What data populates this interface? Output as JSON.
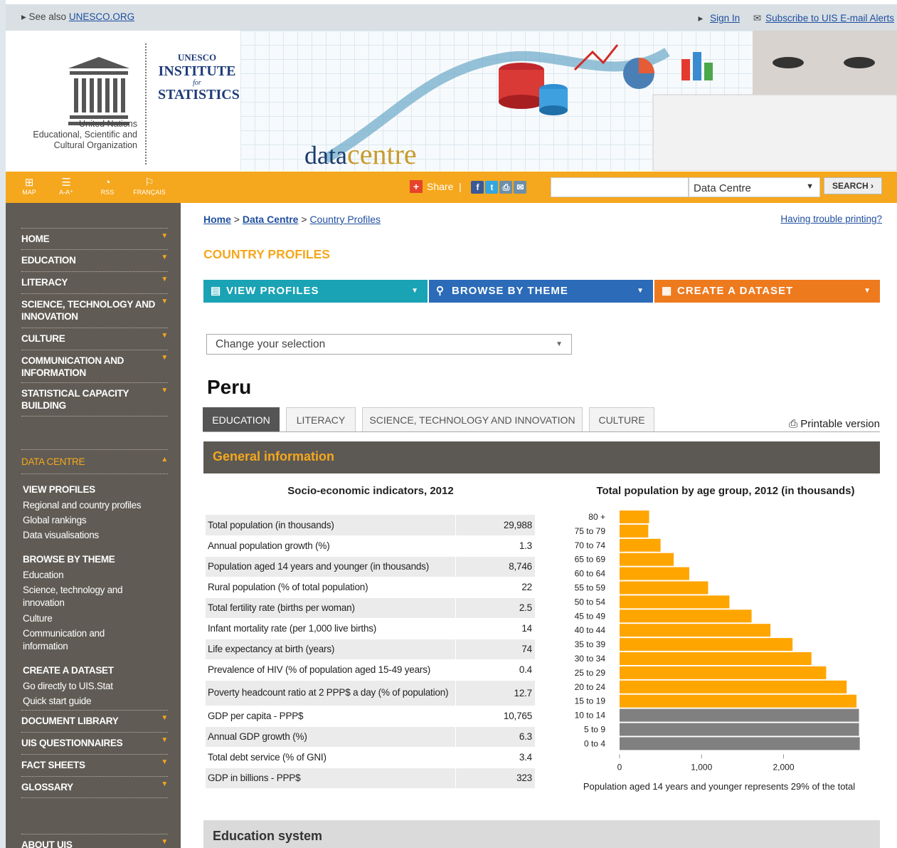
{
  "topbar": {
    "see_also": "See also",
    "unesco_link": "UNESCO.ORG",
    "sign_in": "Sign In",
    "subscribe": "Subscribe to UIS E-mail Alerts"
  },
  "logo": {
    "line1": "United Nations",
    "line2": "Educational, Scientific and",
    "line3": "Cultural Organization",
    "uis_a": "UNESCO",
    "uis_b1": "INSTITUTE",
    "uis_c": "for",
    "uis_b2": "STATISTICS",
    "datacentre_a": "data",
    "datacentre_b": "centre"
  },
  "toolbar": {
    "map": "MAP",
    "aa": "A-A⁺",
    "rss": "RSS",
    "francais": "FRANÇAIS",
    "share": "Share",
    "search_scope": "Data Centre",
    "search_btn": "SEARCH ›"
  },
  "sidebar": {
    "items": [
      "HOME",
      "EDUCATION",
      "LITERACY",
      "SCIENCE, TECHNOLOGY AND INNOVATION",
      "CULTURE",
      "COMMUNICATION AND INFORMATION",
      "STATISTICAL CAPACITY BUILDING"
    ],
    "data_centre": "DATA CENTRE",
    "view_profiles": "VIEW PROFILES",
    "vp_links": [
      "Regional and country profiles",
      "Global rankings",
      "Data visualisations"
    ],
    "browse": "BROWSE BY THEME",
    "browse_links": [
      "Education",
      "Science, technology and innovation",
      "Culture",
      "Communication and information"
    ],
    "create": "CREATE A DATASET",
    "create_links": [
      "Go directly to UIS.Stat",
      "Quick start guide"
    ],
    "bottom_items": [
      "DOCUMENT LIBRARY",
      "UIS QUESTIONNAIRES",
      "FACT SHEETS",
      "GLOSSARY"
    ],
    "about": "ABOUT UIS"
  },
  "breadcrumb": {
    "home": "Home",
    "data_centre": "Data Centre",
    "country_profiles": "Country Profiles",
    "trouble": "Having trouble printing?"
  },
  "page_title": "COUNTRY PROFILES",
  "pills": {
    "view": "VIEW PROFILES",
    "browse": "BROWSE BY THEME",
    "create": "CREATE A DATASET"
  },
  "selection": "Change your selection",
  "country": "Peru",
  "tabs": [
    "EDUCATION",
    "LITERACY",
    "SCIENCE, TECHNOLOGY AND INNOVATION",
    "CULTURE"
  ],
  "printable": "Printable version",
  "general_info": "General information",
  "table": {
    "title": "Socio-economic indicators, 2012",
    "rows": [
      [
        "Total population (in thousands)",
        "29,988"
      ],
      [
        "Annual population growth (%)",
        "1.3"
      ],
      [
        "Population aged 14 years and younger (in thousands)",
        "8,746"
      ],
      [
        "Rural population (% of total population)",
        "22"
      ],
      [
        "Total fertility rate (births per woman)",
        "2.5"
      ],
      [
        "Infant mortality rate (per 1,000 live births)",
        "14"
      ],
      [
        "Life expectancy at birth (years)",
        "74"
      ],
      [
        "Prevalence of HIV (% of population aged 15-49 years)",
        "0.4"
      ],
      [
        "Poverty headcount ratio at 2 PPP$ a day (% of population)",
        "12.7"
      ],
      [
        "GDP per capita - PPP$",
        "10,765"
      ],
      [
        "Annual GDP growth (%)",
        "6.3"
      ],
      [
        "Total debt service (% of GNI)",
        "3.4"
      ],
      [
        "GDP in billions - PPP$",
        "323"
      ]
    ]
  },
  "chart_data": {
    "type": "bar",
    "title": "Total population by age group, 2012 (in thousands)",
    "orientation": "horizontal",
    "categories": [
      "80 +",
      "75 to 79",
      "70 to 74",
      "65 to 69",
      "60 to 64",
      "55 to 59",
      "50 to 54",
      "45 to 49",
      "40 to 44",
      "35 to 39",
      "30 to 34",
      "25 to 29",
      "20 to 24",
      "15 to 19",
      "10 to 14",
      "5 to 9",
      "0 to 4"
    ],
    "values": [
      360,
      350,
      500,
      660,
      850,
      1080,
      1340,
      1610,
      1840,
      2110,
      2340,
      2520,
      2770,
      2890,
      2920,
      2920,
      2930
    ],
    "colors": [
      "#ffa500",
      "#ffa500",
      "#ffa500",
      "#ffa500",
      "#ffa500",
      "#ffa500",
      "#ffa500",
      "#ffa500",
      "#ffa500",
      "#ffa500",
      "#ffa500",
      "#ffa500",
      "#ffa500",
      "#ffa500",
      "#808080",
      "#808080",
      "#808080"
    ],
    "xticks": [
      0,
      1000,
      2000
    ],
    "xtick_labels": [
      "0",
      "1,000",
      "2,000"
    ],
    "xlim": [
      0,
      2950
    ],
    "note": "Population aged 14 years and younger represents 29% of the total"
  },
  "education_system": "Education system"
}
